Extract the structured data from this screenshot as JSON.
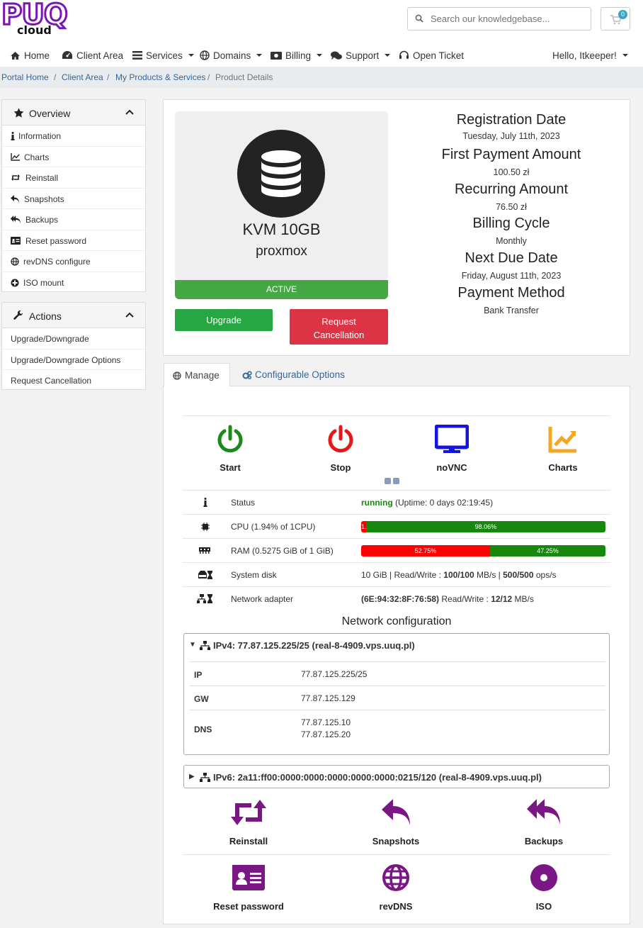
{
  "header": {
    "logo_top": "PUQ",
    "logo_bottom": "cloud",
    "search_placeholder": "Search our knowledgebase...",
    "cart_count": "0",
    "nav": [
      {
        "label": "Home",
        "icon": "home-icon"
      },
      {
        "label": "Client Area",
        "icon": "dashboard-icon"
      },
      {
        "label": "Services",
        "icon": "list-icon"
      },
      {
        "label": "Domains",
        "icon": "globe-icon"
      },
      {
        "label": "Billing",
        "icon": "money-icon"
      },
      {
        "label": "Support",
        "icon": "comments-icon"
      },
      {
        "label": "Open Ticket",
        "icon": "headset-icon"
      }
    ],
    "user_greeting": "Hello, Itkeeper!"
  },
  "breadcrumb": {
    "items": [
      "Portal Home",
      "Client Area",
      "My Products & Services",
      "Product Details"
    ]
  },
  "sidebar": {
    "overview": {
      "title": "Overview",
      "items": [
        "Information",
        "Charts",
        "Reinstall",
        "Snapshots",
        "Backups",
        "Reset password",
        "revDNS configure",
        "ISO mount"
      ]
    },
    "actions": {
      "title": "Actions",
      "items": [
        "Upgrade/Downgrade",
        "Upgrade/Downgrade Options",
        "Request Cancellation"
      ]
    }
  },
  "product": {
    "name": "KVM 10GB",
    "group": "proxmox",
    "status": "ACTIVE",
    "upgrade_label": "Upgrade",
    "cancel_label_1": "Request",
    "cancel_label_2": "Cancellation"
  },
  "details": [
    {
      "label": "Registration Date",
      "value": "Tuesday, July 11th, 2023"
    },
    {
      "label": "First Payment Amount",
      "value": "100.50 zł"
    },
    {
      "label": "Recurring Amount",
      "value": "76.50 zł"
    },
    {
      "label": "Billing Cycle",
      "value": "Monthly"
    },
    {
      "label": "Next Due Date",
      "value": "Friday, August 11th, 2023"
    },
    {
      "label": "Payment Method",
      "value": "Bank Transfer"
    }
  ],
  "tabs": [
    "Manage",
    "Configurable Options"
  ],
  "vm_actions": [
    "Start",
    "Stop",
    "noVNC",
    "Charts"
  ],
  "colors": {
    "start": "#1a8a1a",
    "stop": "#e8151a",
    "novnc": "#1414e0",
    "charts": "#f5a623",
    "purple": "#7a1785",
    "green": "#18870e",
    "red": "#ff0000"
  },
  "stats": {
    "status_label": "Status",
    "status_value": "running",
    "uptime": "(Uptime: 0 days 02:19:45)",
    "cpu_label": "CPU (1.94% of 1CPU)",
    "cpu_used": 1.94,
    "cpu_used_text": "1.",
    "cpu_free_text": "98.06%",
    "ram_label": "RAM (0.5275 GiB of 1 GiB)",
    "ram_used": 52.75,
    "ram_used_text": "52.75%",
    "ram_free_text": "47.25%",
    "disk_label": "System disk",
    "disk_size": "10 GiB | Read/Write : ",
    "disk_mbs": "100/100",
    "disk_unit": " MB/s | ",
    "disk_ops": "500/500",
    "disk_ops_unit": " ops/s",
    "net_label": "Network adapter",
    "net_mac": "(6E:94:32:8F:76:58)",
    "net_rw": " Read/Write : ",
    "net_mbs": "12/12",
    "net_unit": " MB/s"
  },
  "network": {
    "title": "Network configuration",
    "ipv4_header": "IPv4: 77.87.125.225/25 (real-8-4909.vps.uuq.pl)",
    "ip_label": "IP",
    "ip_value": "77.87.125.225/25",
    "gw_label": "GW",
    "gw_value": "77.87.125.129",
    "dns_label": "DNS",
    "dns_1": "77.87.125.10",
    "dns_2": "77.87.125.20",
    "ipv6_header": "IPv6: 2a11:ff00:0000:0000:0000:0000:0000:0215/120 (real-8-4909.vps.uuq.pl)"
  },
  "tools": [
    "Reinstall",
    "Snapshots",
    "Backups",
    "Reset password",
    "revDNS",
    "ISO"
  ]
}
